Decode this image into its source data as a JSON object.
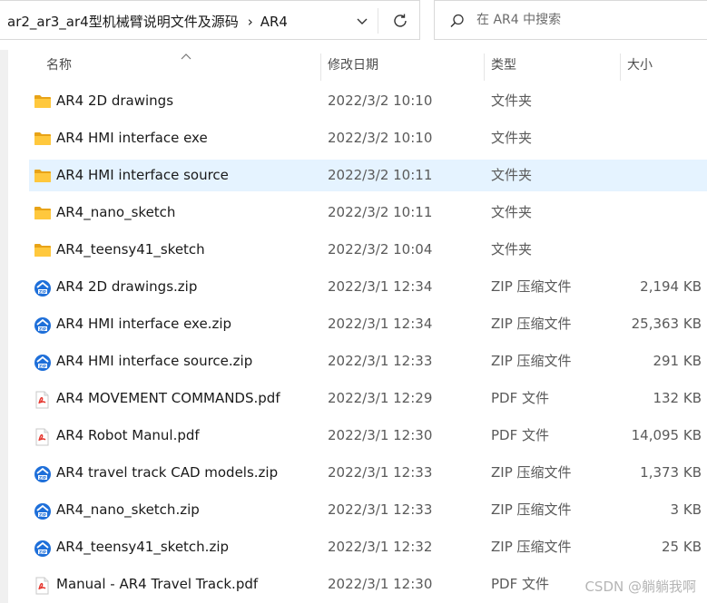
{
  "address_bar": {
    "crumbs": [
      "ar2_ar3_ar4型机械臂说明文件及源码",
      "AR4"
    ],
    "separator": "›"
  },
  "search": {
    "placeholder": "在 AR4 中搜索"
  },
  "columns": {
    "name": "名称",
    "modified": "修改日期",
    "type": "类型",
    "size": "大小"
  },
  "files": [
    {
      "name": "AR4 2D drawings",
      "modified": "2022/3/2 10:10",
      "type": "文件夹",
      "size": "",
      "icon": "folder-icon"
    },
    {
      "name": "AR4 HMI interface exe",
      "modified": "2022/3/2 10:10",
      "type": "文件夹",
      "size": "",
      "icon": "folder-icon"
    },
    {
      "name": "AR4 HMI interface source",
      "modified": "2022/3/2 10:11",
      "type": "文件夹",
      "size": "",
      "icon": "folder-icon",
      "selected": true
    },
    {
      "name": "AR4_nano_sketch",
      "modified": "2022/3/2 10:11",
      "type": "文件夹",
      "size": "",
      "icon": "folder-icon"
    },
    {
      "name": "AR4_teensy41_sketch",
      "modified": "2022/3/2 10:04",
      "type": "文件夹",
      "size": "",
      "icon": "folder-icon"
    },
    {
      "name": "AR4 2D drawings.zip",
      "modified": "2022/3/1 12:34",
      "type": "ZIP 压缩文件",
      "size": "2,194 KB",
      "icon": "zip-icon"
    },
    {
      "name": "AR4 HMI interface exe.zip",
      "modified": "2022/3/1 12:34",
      "type": "ZIP 压缩文件",
      "size": "25,363 KB",
      "icon": "zip-icon"
    },
    {
      "name": "AR4 HMI interface source.zip",
      "modified": "2022/3/1 12:33",
      "type": "ZIP 压缩文件",
      "size": "291 KB",
      "icon": "zip-icon"
    },
    {
      "name": "AR4 MOVEMENT COMMANDS.pdf",
      "modified": "2022/3/1 12:29",
      "type": "PDF 文件",
      "size": "132 KB",
      "icon": "pdf-icon"
    },
    {
      "name": "AR4 Robot Manul.pdf",
      "modified": "2022/3/1 12:30",
      "type": "PDF 文件",
      "size": "14,095 KB",
      "icon": "pdf-icon"
    },
    {
      "name": "AR4 travel track CAD models.zip",
      "modified": "2022/3/1 12:33",
      "type": "ZIP 压缩文件",
      "size": "1,373 KB",
      "icon": "zip-icon"
    },
    {
      "name": "AR4_nano_sketch.zip",
      "modified": "2022/3/1 12:33",
      "type": "ZIP 压缩文件",
      "size": "3 KB",
      "icon": "zip-icon"
    },
    {
      "name": "AR4_teensy41_sketch.zip",
      "modified": "2022/3/1 12:32",
      "type": "ZIP 压缩文件",
      "size": "25 KB",
      "icon": "zip-icon"
    },
    {
      "name": "Manual - AR4 Travel Track.pdf",
      "modified": "2022/3/1 12:30",
      "type": "PDF 文件",
      "size": "",
      "icon": "pdf-icon"
    }
  ],
  "watermark": "CSDN @躺躺我啊",
  "colors": {
    "selected_row": "#e5f3ff",
    "folder": "#ffc83d",
    "zip_badge": "#1e6fd9",
    "pdf_red": "#e5352d"
  }
}
